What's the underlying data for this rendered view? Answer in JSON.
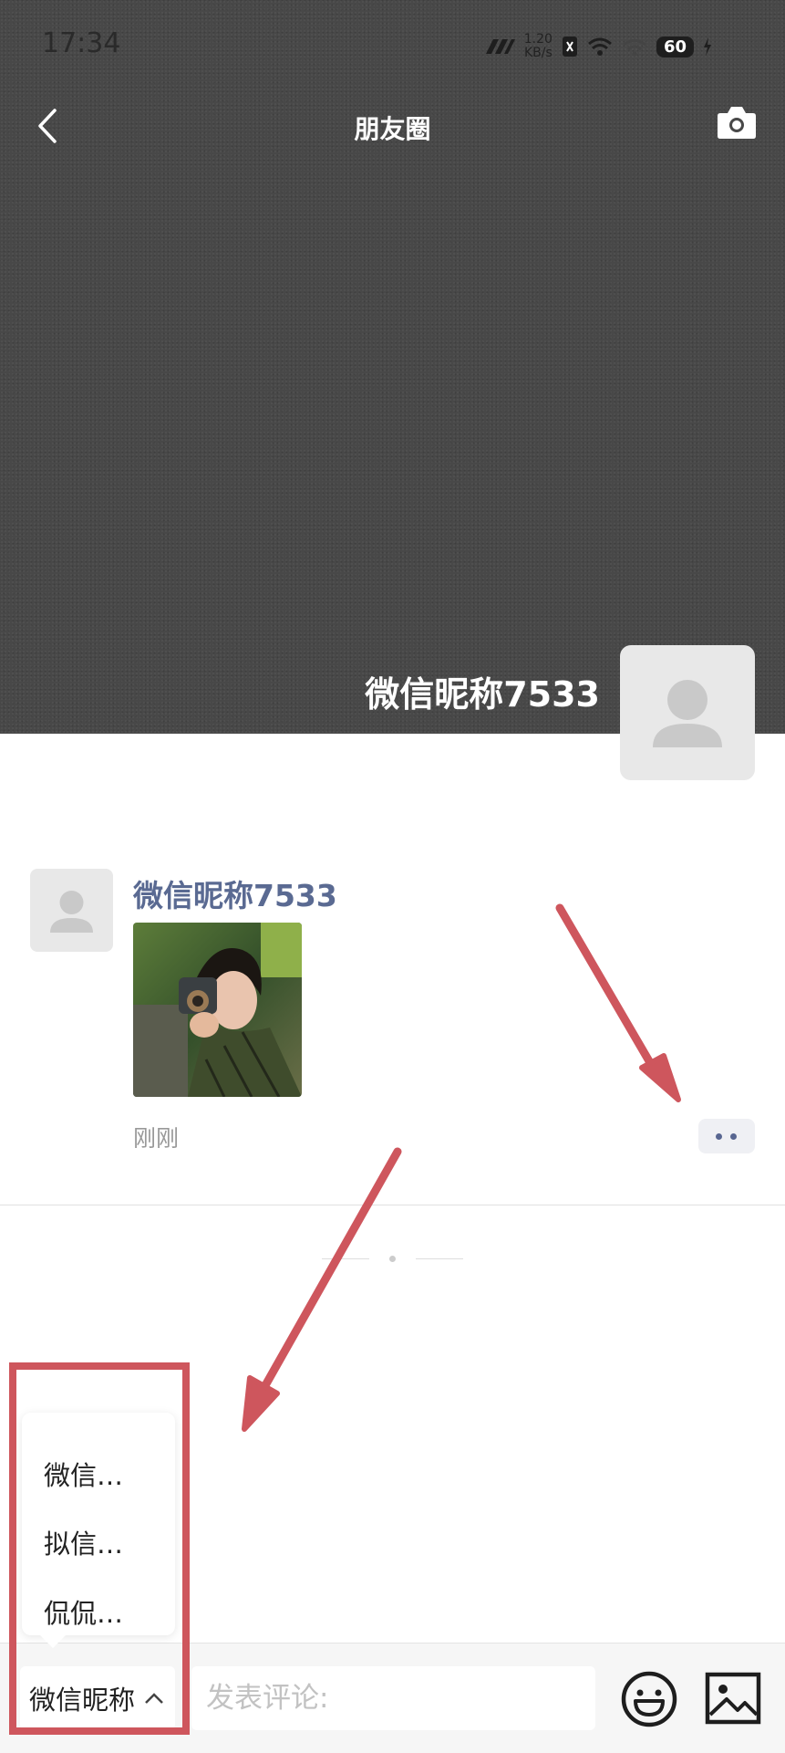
{
  "status_bar": {
    "time": "17:34",
    "net_speed_value": "1.20",
    "net_speed_unit": "KB/s",
    "battery": "60"
  },
  "nav": {
    "title": "朋友圈",
    "back_icon": "chevron-left-icon",
    "camera_icon": "camera-icon"
  },
  "profile": {
    "name": "微信昵称7533"
  },
  "post": {
    "author": "微信昵称7533",
    "time": "刚刚",
    "more_icon": "more-dots-icon"
  },
  "identity_menu": {
    "items": [
      "微信…",
      "拟信…",
      "侃侃…"
    ]
  },
  "comment_bar": {
    "identity_label": "微信昵称",
    "placeholder": "发表评论:",
    "emoji_icon": "emoji-icon",
    "image_icon": "image-icon"
  },
  "colors": {
    "accent_name": "#5a6a92",
    "highlight": "#ce565d",
    "cover": "#484848"
  }
}
